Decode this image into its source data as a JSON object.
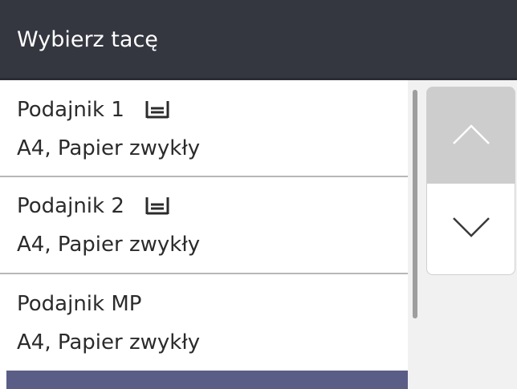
{
  "header": {
    "title": "Wybierz tacę"
  },
  "trays": [
    {
      "name": "Podajnik 1",
      "detail": "A4, Papier zwykły",
      "icon": "paper-tray-icon"
    },
    {
      "name": "Podajnik 2",
      "detail": "A4, Papier zwykły",
      "icon": "paper-tray-icon"
    },
    {
      "name": "Podajnik MP",
      "detail": "A4, Papier zwykły"
    }
  ],
  "scroll": {
    "up_icon": "chevron-up-icon",
    "down_icon": "chevron-down-icon"
  },
  "colors": {
    "header_bg": "#343640",
    "header_text": "#ffffff",
    "list_text": "#2b2b2b",
    "highlight_row": "#5a5e86",
    "divider": "#b7b7b7",
    "side_bg": "#f1f1f1",
    "up_button_bg": "#cdcdcd",
    "down_button_bg": "#ffffff"
  }
}
